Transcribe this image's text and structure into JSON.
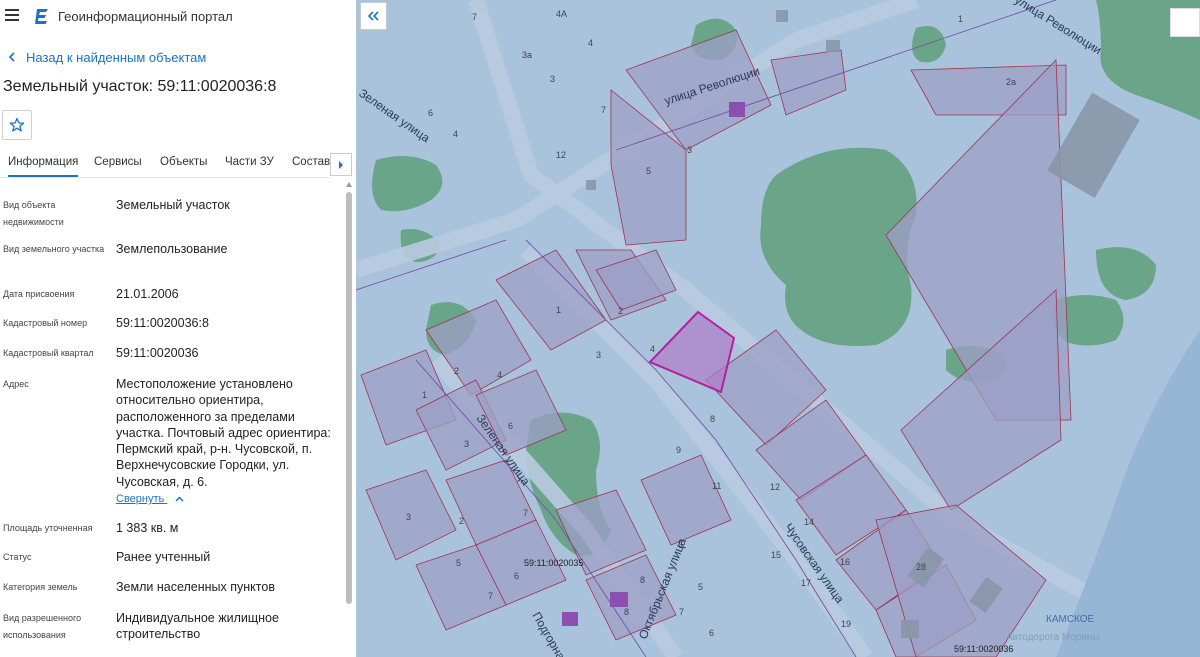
{
  "app": {
    "title": "Геоинформационный портал"
  },
  "nav": {
    "back_label": "Назад к найденным объектам"
  },
  "object": {
    "title": "Земельный участок: 59:11:0020036:8"
  },
  "tabs": [
    {
      "label": "Информация",
      "active": true
    },
    {
      "label": "Сервисы"
    },
    {
      "label": "Объекты"
    },
    {
      "label": "Части ЗУ"
    },
    {
      "label": "Состав"
    }
  ],
  "fields": [
    {
      "label": "Вид объекта недвижимости",
      "value": "Земельный участок"
    },
    {
      "label": "Вид земельного участка",
      "value": "Землепользование"
    },
    {
      "label": "Дата присвоения",
      "value": "21.01.2006"
    },
    {
      "label": "Кадастровый номер",
      "value": "59:11:0020036:8"
    },
    {
      "label": "Кадастровый квартал",
      "value": "59:11:0020036"
    },
    {
      "label": "Адрес",
      "value": "Местоположение установлено относительно ориентира, расположенного за пределами участка. Почтовый адрес ориентира: Пермский край, р-н. Чусовской, п. Верхнечусовские Городки, ул. Чусовская, д. 6."
    },
    {
      "label": "Площадь уточненная",
      "value": "1 383 кв. м"
    },
    {
      "label": "Статус",
      "value": "Ранее учтенный"
    },
    {
      "label": "Категория земель",
      "value": "Земли населенных пунктов"
    },
    {
      "label": "Вид разрешенного использования",
      "value": "Индивидуальное жилищное строительство"
    }
  ],
  "address_toggle": {
    "label": "Свернуть"
  },
  "map": {
    "streets": [
      {
        "label": "улица Революции"
      },
      {
        "label": "улица Революции"
      },
      {
        "label": "Зеленая улица"
      },
      {
        "label": "Зеленая улица"
      },
      {
        "label": "Чусовская улица"
      },
      {
        "label": "Октябрьская улица"
      },
      {
        "label": "Подгорная"
      }
    ],
    "quarters": [
      "59:11:0020035",
      "59:11:0020036"
    ],
    "river_label": "КАМСКОЕ",
    "river_label_2": "Автодорога Морины",
    "house_numbers": [
      "7",
      "4А",
      "4",
      "1",
      "3а",
      "3",
      "2а",
      "6",
      "4",
      "12",
      "7",
      "3",
      "5",
      "1",
      "2",
      "4",
      "3",
      "2",
      "4",
      "6",
      "1",
      "3",
      "7",
      "8",
      "9",
      "11",
      "12",
      "14",
      "15",
      "16",
      "17",
      "19",
      "28",
      "2",
      "3",
      "5",
      "6",
      "7",
      "8",
      "6",
      "5",
      "8",
      "7",
      "6"
    ],
    "colors": {
      "water": "#a9c3dd",
      "green": "#5fa07a",
      "parcel_fill": "#9e9fc6",
      "parcel_line": "#a0344a",
      "selected_fill": "#b07ec9",
      "selected_line": "#b41fa0",
      "road": "#b9cbe0"
    }
  },
  "colors": {
    "accent": "#1a73c9"
  },
  "icons": {
    "menu": "menu-icon",
    "logo": "portal-logo-icon",
    "back": "chevron-left-icon",
    "favorite": "star-icon",
    "tabs_next": "caret-right-icon",
    "collapse": "chevron-up-icon",
    "panel_collapse": "double-chevron-left-icon"
  }
}
